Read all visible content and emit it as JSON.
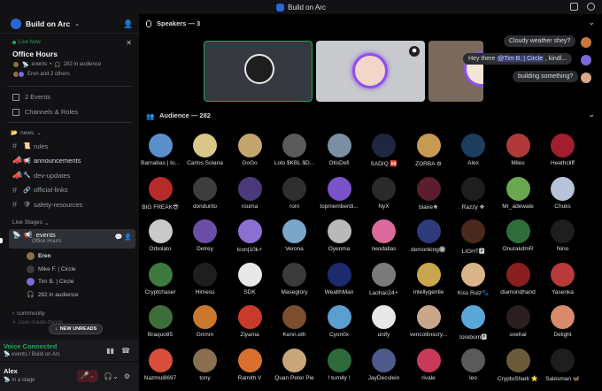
{
  "titlebar": {
    "title": "Build on Arc"
  },
  "server": {
    "name": "Build on Arc"
  },
  "live_event": {
    "label": "Live Now",
    "title": "Office Hours",
    "meta_channel": "events",
    "meta_count": "282 in audience",
    "hosts": "Eren and 2 others"
  },
  "nav": [
    {
      "icon": "calendar-icon",
      "label": "2 Events"
    },
    {
      "icon": "channels-icon",
      "label": "Channels & Roles"
    }
  ],
  "news_category": "news",
  "channels": [
    {
      "emoji": "📜",
      "label": "rules"
    },
    {
      "emoji": "📢",
      "label": "announcements"
    },
    {
      "emoji": "🔧",
      "label": "dev-updates"
    },
    {
      "emoji": "🔗",
      "label": "official-links"
    },
    {
      "emoji": "🛡",
      "label": "safety-resources"
    }
  ],
  "stages_category": "Live Stages",
  "stage": {
    "label": "events",
    "sub": "Office Hours"
  },
  "stage_members": [
    {
      "name": "Eren",
      "color": "#8b6f47"
    },
    {
      "name": "Mike F. | Circle",
      "color": "#3a3a3a"
    },
    {
      "name": "Tim B. | Circle",
      "color": "#7a6ad9"
    },
    {
      "name": "282 in audience",
      "color": "#2b2d31"
    }
  ],
  "community_category": "community",
  "new_unreads": "NEW UNREADS",
  "ghost_channel": "user-made-things",
  "voice": {
    "status": "Voice Connected",
    "sub": "events / Build on Arc"
  },
  "user": {
    "name": "Alex",
    "status": "In a stage"
  },
  "speakers_header": "Speakers — 3",
  "bubbles": [
    {
      "text": "Cloudy weather shey?"
    },
    {
      "prefix": "Hey there ",
      "mention": "@Tim B. | Circle",
      "suffix": " , kindl..."
    },
    {
      "text": "building something?"
    }
  ],
  "audience_header": "Audience — 282",
  "audience": [
    [
      "Barnabas | to...",
      "Carlos.Solana",
      "GoGo",
      "Lolo $KBL $D...",
      "OtisDefi",
      "SADIQ 🆎",
      "ZORBA ⚙",
      "Alex",
      "Miles",
      "Heathcliff"
    ],
    [
      "BIG FREAK😎",
      "dondurito",
      "rouma",
      "roni",
      "topmemberdi...",
      "NyX",
      "biaire❖",
      "Razzy ❖",
      "Mr_adewale",
      "Chuks"
    ],
    [
      "Orbolato",
      "Delrey",
      "Icon|10k⚡",
      "Verona",
      "Oyenma",
      "neodallas",
      "demonking🔘",
      "LIGHT🅿",
      "OnurakdmR",
      "Nino"
    ],
    [
      "Cryptchaser",
      "Himess",
      "SDK",
      "Maseglory",
      "WealthMan",
      "Laohac24⚡",
      "Intellygentle",
      "Kiss Rulz🐾",
      "diamondhand",
      "Yasenka"
    ],
    [
      "Braquo85",
      "Grimm",
      "Ziyama",
      "Kenn.eth",
      "Cyon0x",
      "unify",
      "vencollinscry...",
      "toreborn🅿",
      "snehal",
      "Delight"
    ],
    [
      "Nazmul8697",
      "tony",
      "Ramith.V",
      "Quan Peter Pie",
      "! tum4y !",
      "JayDeculein",
      "rivale",
      "leo",
      "CryptoShark ⭐",
      "Salesman 🦋"
    ]
  ],
  "avatar_colors": [
    [
      "#5b8fc9",
      "#d9c78a",
      "#c2a66e",
      "#5a5a5a",
      "#7a8fa3",
      "#1f2640",
      "#c79a52",
      "#1d3d5c",
      "#b03a3a",
      "#a01e2e"
    ],
    [
      "#b72a2a",
      "#3d3d3d",
      "#4a3a7a",
      "#2f2f2f",
      "#7a52c9",
      "#2a2a2a",
      "#5c1e2e",
      "#1e1e1e",
      "#6aa84f",
      "#b5c4d9"
    ],
    [
      "#c9c9c9",
      "#6b4ea8",
      "#8c6fd1",
      "#7aa6c9",
      "#b9b9b9",
      "#d96a9a",
      "#2e3a7a",
      "#4a2a1e",
      "#2f6e3a",
      "#1e1e1e"
    ],
    [
      "#3d7a3d",
      "#1e1e1e",
      "#e8e8e8",
      "#3a3a3a",
      "#1e2a6e",
      "#7a7a7a",
      "#c9a64e",
      "#d9b48a",
      "#8a1e1e",
      "#b83a3a"
    ],
    [
      "#3d6e3a",
      "#c9782e",
      "#c93a2a",
      "#7a4e2e",
      "#5b9ed1",
      "#e8e8e8",
      "#c9a68a",
      "#5ba6d9",
      "#2a1e1e",
      "#d98a6a"
    ],
    [
      "#d94e3a",
      "#8a6e4e",
      "#d9702e",
      "#c9a67a",
      "#2e6a3a",
      "#4e5a8a",
      "#c93a5a",
      "#5a5a5a",
      "#6a5a3a",
      "#1e1e1e"
    ]
  ]
}
